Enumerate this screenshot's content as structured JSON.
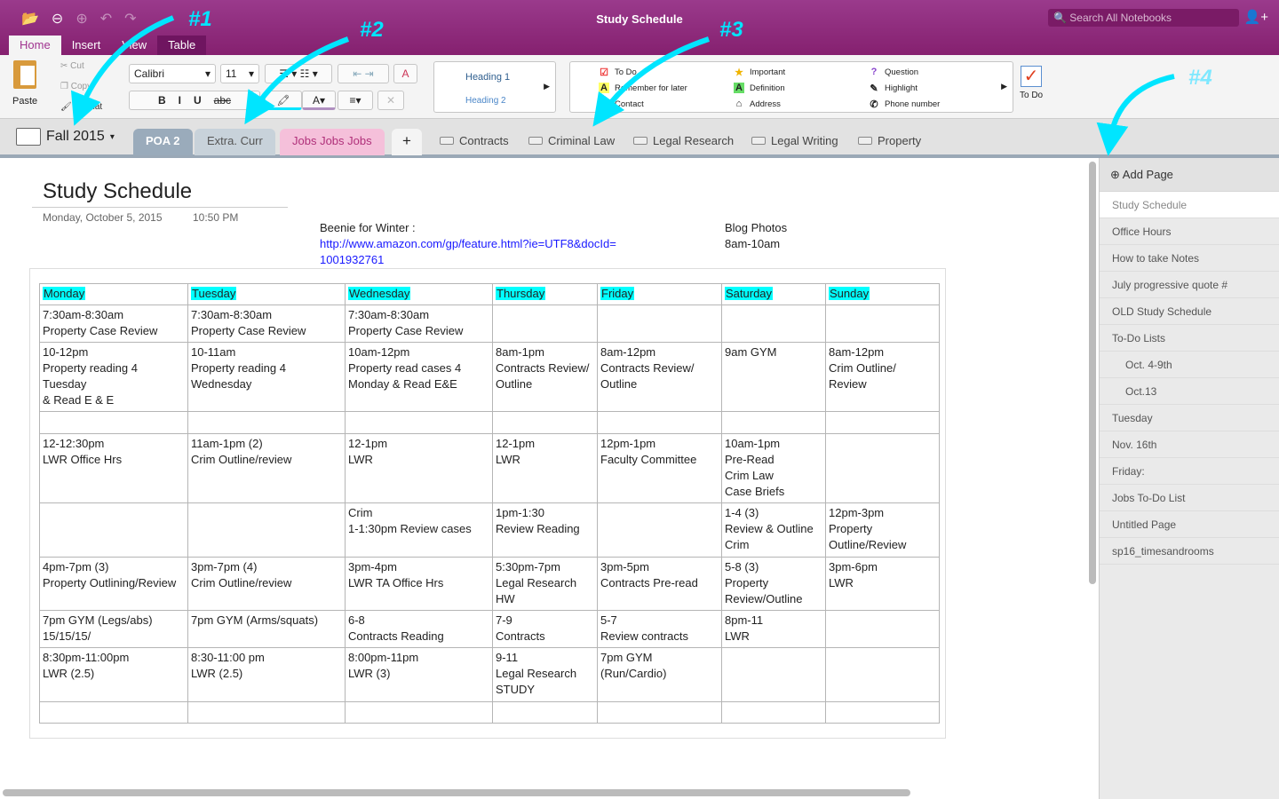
{
  "app": {
    "title": "Study Schedule",
    "search_placeholder": "Search All Notebooks"
  },
  "menu_tabs": [
    "Home",
    "Insert",
    "View",
    "Table"
  ],
  "ribbon": {
    "paste": "Paste",
    "cut": "Cut",
    "copy": "Copy",
    "format": "Format",
    "font": "Calibri",
    "size": "11",
    "heading1": "Heading 1",
    "heading2": "Heading 2",
    "todo_label": "To Do"
  },
  "tags": [
    {
      "icon": "checkbox",
      "label": "To Do"
    },
    {
      "icon": "A",
      "label": "Remember for later"
    },
    {
      "icon": "contact",
      "label": "Contact"
    },
    {
      "icon": "star",
      "label": "Important"
    },
    {
      "icon": "A",
      "label": "Definition"
    },
    {
      "icon": "house",
      "label": "Address"
    },
    {
      "icon": "?",
      "label": "Question"
    },
    {
      "icon": "pen",
      "label": "Highlight"
    },
    {
      "icon": "phone",
      "label": "Phone number"
    }
  ],
  "notebook": "Fall 2015",
  "sections": [
    "POA 2",
    "Extra. Curr",
    "Jobs Jobs Jobs"
  ],
  "section_groups": [
    "Contracts",
    "Criminal Law",
    "Legal Research",
    "Legal Writing",
    "Property"
  ],
  "page": {
    "title": "Study Schedule",
    "date": "Monday, October 5, 2015",
    "time": "10:50 PM",
    "note1": "Beenie for Winter :",
    "link1": "http://www.amazon.com/gp/feature.html?ie=UTF8&docId=",
    "link2": "1001932761",
    "note2a": "Blog Photos",
    "note2b": "8am-10am"
  },
  "table": {
    "headers": [
      "Monday",
      "Tuesday",
      "Wednesday",
      "Thursday",
      "Friday",
      "Saturday",
      "Sunday"
    ],
    "rows": [
      [
        "7:30am-8:30am\nProperty Case Review",
        "7:30am-8:30am\nProperty Case Review",
        "7:30am-8:30am\nProperty Case Review",
        "",
        "",
        "",
        ""
      ],
      [
        "10-12pm\nProperty reading 4\nTuesday\n& Read E & E",
        "10-11am\nProperty reading 4\nWednesday",
        "10am-12pm\nProperty read cases 4\nMonday  & Read E&E",
        "8am-1pm\nContracts Review/\nOutline",
        "8am-12pm\nContracts Review/\nOutline",
        "9am GYM",
        "8am-12pm\nCrim Outline/\nReview"
      ],
      [
        "",
        "",
        "",
        "",
        "",
        "",
        ""
      ],
      [
        "12-12:30pm\nLWR Office Hrs",
        "11am-1pm (2)\nCrim Outline/review",
        "12-1pm\nLWR",
        "12-1pm\nLWR",
        "12pm-1pm\nFaculty Committee",
        "10am-1pm\nPre-Read\nCrim Law\nCase Briefs",
        ""
      ],
      [
        "",
        "",
        "Crim\n1-1:30pm Review cases",
        "1pm-1:30\nReview Reading",
        "",
        "1-4 (3)\nReview & Outline\nCrim",
        "12pm-3pm\nProperty\nOutline/Review"
      ],
      [
        "4pm-7pm (3)\nProperty Outlining/Review",
        "3pm-7pm (4)\nCrim Outline/review",
        "3pm-4pm\nLWR TA Office Hrs",
        "5:30pm-7pm\nLegal Research\nHW",
        "3pm-5pm\nContracts Pre-read",
        "5-8 (3)\nProperty\nReview/Outline",
        "3pm-6pm\nLWR"
      ],
      [
        "7pm GYM (Legs/abs)\n15/15/15/",
        "7pm GYM (Arms/squats)",
        "6-8\nContracts Reading",
        "7-9\nContracts",
        "5-7\nReview contracts",
        "8pm-11\nLWR",
        ""
      ],
      [
        "8:30pm-11:00pm\nLWR (2.5)",
        "8:30-11:00 pm\nLWR (2.5)",
        "8:00pm-11pm\nLWR (3)",
        "9-11\nLegal Research\nSTUDY",
        "7pm GYM\n(Run/Cardio)",
        "",
        ""
      ],
      [
        "",
        "",
        "",
        "",
        "",
        "",
        ""
      ]
    ]
  },
  "sidebar": {
    "add_page": "Add Page",
    "pages": [
      {
        "label": "Study Schedule",
        "level": 0,
        "selected": true
      },
      {
        "label": "Office Hours",
        "level": 0
      },
      {
        "label": "How to take Notes",
        "level": 0
      },
      {
        "label": "July progressive quote #",
        "level": 0
      },
      {
        "label": "OLD Study Schedule",
        "level": 0
      },
      {
        "label": "To-Do Lists",
        "level": 0
      },
      {
        "label": "Oct. 4-9th",
        "level": 1
      },
      {
        "label": "Oct.13",
        "level": 1
      },
      {
        "label": "Tuesday",
        "level": 0
      },
      {
        "label": "Nov. 16th",
        "level": 0
      },
      {
        "label": "Friday:",
        "level": 0
      },
      {
        "label": "Jobs To-Do List",
        "level": 0
      },
      {
        "label": "Untitled Page",
        "level": 0
      },
      {
        "label": "sp16_timesandrooms",
        "level": 0
      }
    ]
  },
  "annotations": [
    "#1",
    "#2",
    "#3",
    "#4"
  ],
  "colors": {
    "titlebar": "#8e2a7c",
    "highlight": "#00ffff",
    "arrow": "#00e5ff",
    "section_poa": "#9aabbb",
    "section_extra": "#c8d2da",
    "section_jobs": "#f5c0da"
  }
}
